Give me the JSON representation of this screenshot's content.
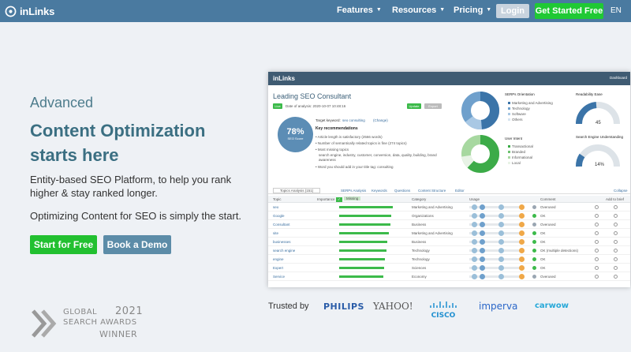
{
  "nav": {
    "logo_text": "inLinks",
    "items": [
      {
        "label": "Features"
      },
      {
        "label": "Resources"
      },
      {
        "label": "Pricing"
      }
    ],
    "login_label": "Login",
    "get_started_label": "Get Started Free",
    "language": "EN"
  },
  "hero": {
    "kicker": "Advanced",
    "headline_line1": "Content Optimization",
    "headline_line2": "starts here",
    "description": "Entity-based SEO Platform, to help you rank higher & stay ranked longer.",
    "subline": "Optimizing Content for SEO is simply the start.",
    "start_free_label": "Start for Free",
    "book_demo_label": "Book a Demo"
  },
  "award": {
    "line1": "GLOBAL",
    "year": "2021",
    "line2": "SEARCH AWARDS",
    "line3": "WINNER"
  },
  "trusted": {
    "label": "Trusted by",
    "brands": [
      "PHILIPS",
      "YAHOO!",
      "CISCO",
      "imperva",
      "carwow"
    ]
  },
  "dashboard": {
    "logo": "inLinks",
    "dashboard_label": "Dashboard",
    "title": "Leading SEO Consultant",
    "status_chip": "Live Link",
    "date_text": "Date of analysis: 2020-10-07 10:48:16",
    "update_label": "Update",
    "export_label": "Export",
    "target_keyword_label": "Target keyword:",
    "target_keyword": "seo consulting",
    "change_label": "(Change)",
    "score_value": "78%",
    "score_label": "SEO Score",
    "key_rec_title": "Key recommendations",
    "recommendations": [
      "Article length is satisfactory (2566 words)",
      "Number of semantically related topics is fine (274 topics)",
      "Most missing topics",
      "search engine, industry, customer, conversion, data, quality, building, brand",
      "awareness",
      "Word you should add in your title tag: consulting"
    ],
    "serp_title": "SERPs Orientation",
    "serp_legend": [
      "Marketing and Advertising",
      "Technology",
      "Software",
      "Others"
    ],
    "intent_title": "User Intent",
    "intent_legend": [
      "Transactional",
      "Branded",
      "Informational",
      "Local"
    ],
    "readability_title": "Readability Ease",
    "readability_value": "45",
    "understanding_title": "Search Engine Understanding",
    "understanding_value": "14%",
    "tabs": [
      "Topics Analysis (151)",
      "SERPs Analysis",
      "Keywords",
      "Questions",
      "Content Structure",
      "Editor"
    ],
    "collapse_label": "Collapse",
    "table_headers": {
      "topic": "Topic",
      "importance": "Importance",
      "missing": "Missing",
      "category": "Category",
      "usage": "Usage",
      "comment": "Comment",
      "add_to_brief": "Add to brief"
    },
    "rows": [
      {
        "topic": "seo",
        "category": "Marketing and Advertising",
        "comment": "Overused",
        "importance": 1.0
      },
      {
        "topic": "Google",
        "category": "Organizations",
        "comment": "OK",
        "importance": 0.97
      },
      {
        "topic": "Consultant",
        "category": "Business",
        "comment": "Overused",
        "importance": 0.95
      },
      {
        "topic": "site",
        "category": "Marketing and Advertising",
        "comment": "OK",
        "importance": 0.92
      },
      {
        "topic": "businesses",
        "category": "Business",
        "comment": "OK",
        "importance": 0.9
      },
      {
        "topic": "search engine",
        "category": "Technology",
        "comment": "OK (multiple detections)",
        "importance": 0.88
      },
      {
        "topic": "engine",
        "category": "Technology",
        "comment": "OK",
        "importance": 0.86
      },
      {
        "topic": "Expert",
        "category": "Sciences",
        "comment": "OK",
        "importance": 0.84
      },
      {
        "topic": "Service",
        "category": "Economy",
        "comment": "Overused",
        "importance": 0.82
      }
    ]
  },
  "colors": {
    "nav_bg": "#4a7aa0",
    "accent_green": "#1fc934",
    "heading_teal": "#3b6f82",
    "demo_button": "#5c8ca8"
  }
}
